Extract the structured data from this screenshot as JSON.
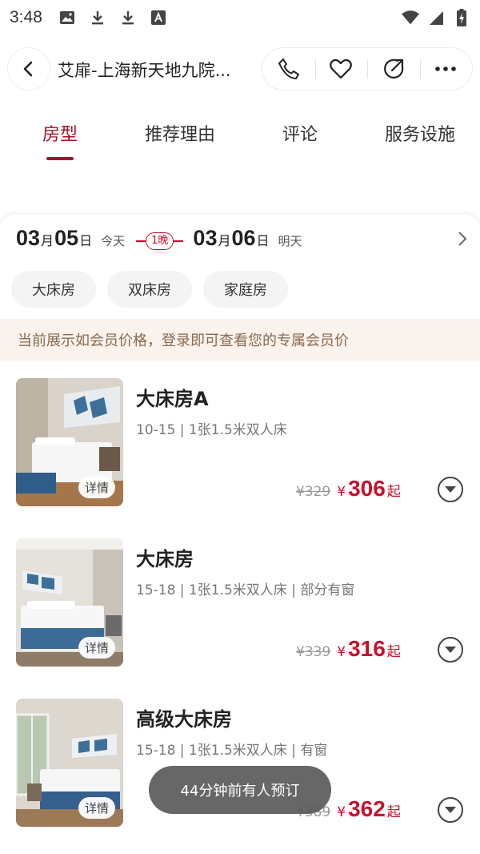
{
  "status_bar": {
    "time": "3:48",
    "left_icons": [
      "image-icon",
      "download-icon",
      "download-icon",
      "text-a-icon"
    ],
    "right_icons": [
      "wifi-icon",
      "signal-icon",
      "battery-charging-icon"
    ]
  },
  "header": {
    "title": "艾扉-上海新天地九院...",
    "actions": [
      "phone-icon",
      "heart-icon",
      "share-icon",
      "more-icon"
    ]
  },
  "tabs": [
    {
      "label": "房型",
      "active": true
    },
    {
      "label": "推荐理由",
      "active": false
    },
    {
      "label": "评论",
      "active": false
    },
    {
      "label": "服务设施",
      "active": false
    }
  ],
  "booking": {
    "checkin": {
      "month": "03",
      "month_unit": "月",
      "day": "05",
      "day_unit": "日",
      "weekday": "今天"
    },
    "nights": "1晚",
    "checkout": {
      "month": "03",
      "month_unit": "月",
      "day": "06",
      "day_unit": "日",
      "weekday": "明天"
    }
  },
  "filters": [
    "大床房",
    "双床房",
    "家庭房"
  ],
  "member_notice": "当前展示如会员价格，登录即可查看您的专属会员价",
  "rooms": [
    {
      "name": "大床房A",
      "desc": "10-15 | 1张1.5米双人床",
      "old_price": "¥329",
      "currency": "¥",
      "price": "306",
      "suffix": "起",
      "detail": "详情"
    },
    {
      "name": "大床房",
      "desc": "15-18 | 1张1.5米双人床 | 部分有窗",
      "old_price": "¥339",
      "currency": "¥",
      "price": "316",
      "suffix": "起",
      "detail": "详情"
    },
    {
      "name": "高级大床房",
      "desc": "15-18 | 1张1.5米双人床 | 有窗",
      "old_price": "¥389",
      "currency": "¥",
      "price": "362",
      "suffix": "起",
      "detail": "详情"
    }
  ],
  "toast": "44分钟前有人预订",
  "colors": {
    "accent": "#a3122d",
    "price": "#c8102e",
    "banner_bg": "#f9f2ed",
    "banner_text": "#8a6a4d"
  }
}
